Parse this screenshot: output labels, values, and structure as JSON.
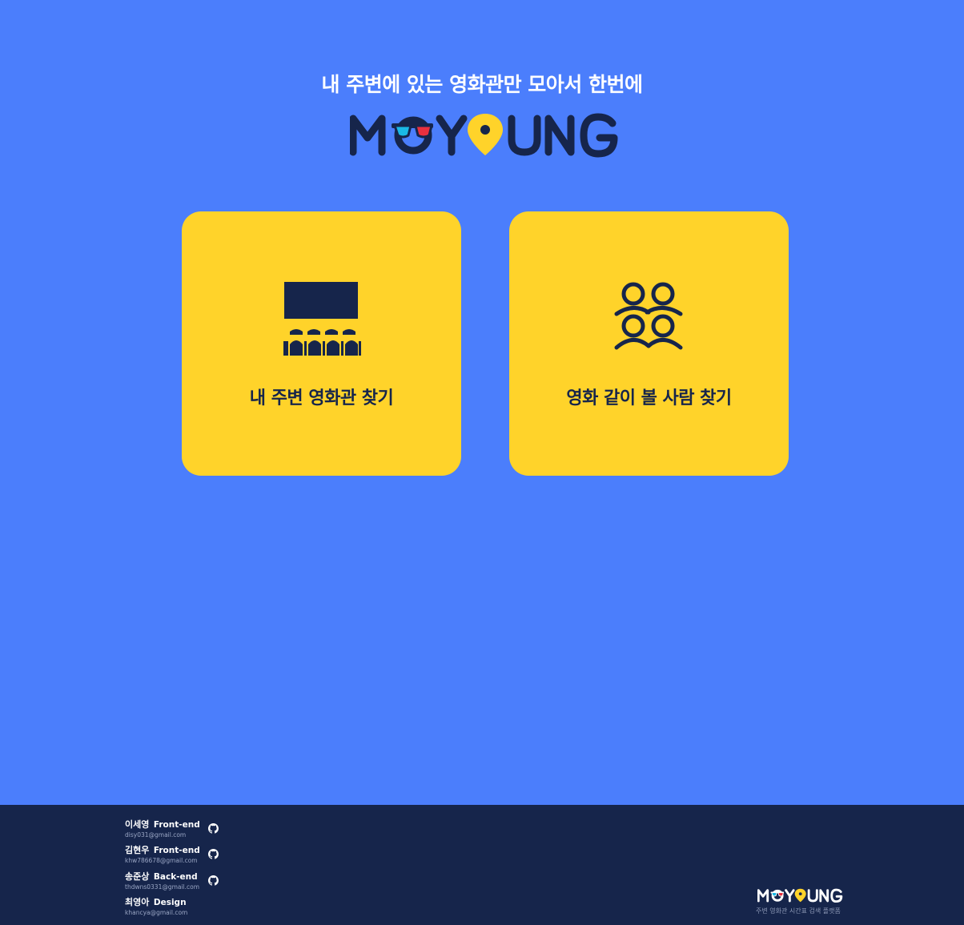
{
  "hero": {
    "tagline": "내 주변에 있는 영화관만 모아서 한번에",
    "logo_text": "MOYOUNG",
    "logo_icon": "3d-glasses-and-pin-logo"
  },
  "cards": [
    {
      "label": "내 주변 영화관 찾기",
      "icon": "theater-seats-icon"
    },
    {
      "label": "영화 같이 볼 사람 찾기",
      "icon": "people-group-icon"
    }
  ],
  "footer": {
    "members": [
      {
        "name": "이세영",
        "role": "Front-end",
        "email": "disy031@gmail.com",
        "has_github": true
      },
      {
        "name": "김현우",
        "role": "Front-end",
        "email": "khw786678@gmail.com",
        "has_github": true
      },
      {
        "name": "송준상",
        "role": "Back-end",
        "email": "thdwns0331@gmail.com",
        "has_github": true
      },
      {
        "name": "최영아",
        "role": "Design",
        "email": "khancya@gmail.com",
        "has_github": false
      }
    ],
    "logo_text": "MOYOUNG",
    "subtitle": "주변 영화관 시간표 검색 플랫폼"
  },
  "colors": {
    "background": "#4b7efc",
    "card": "#ffd32a",
    "navy": "#16254b",
    "pin_yellow": "#ffd32a",
    "glasses_cyan": "#1ab8e6",
    "glasses_red": "#e8303f"
  }
}
